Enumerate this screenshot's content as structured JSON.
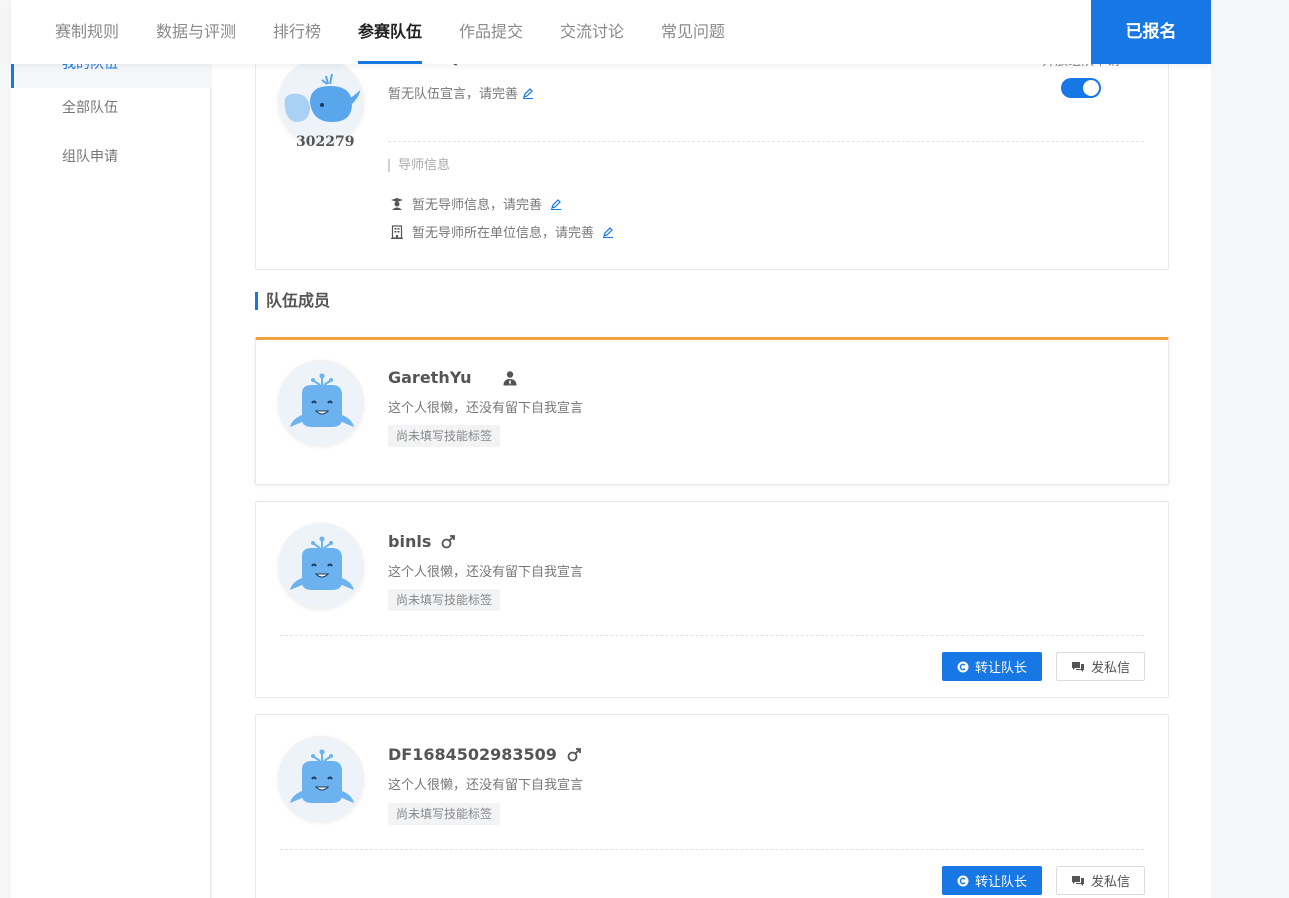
{
  "tabs": [
    {
      "label": "赛制规则",
      "active": false
    },
    {
      "label": "数据与评测",
      "active": false
    },
    {
      "label": "排行榜",
      "active": false
    },
    {
      "label": "参赛队伍",
      "active": true
    },
    {
      "label": "作品提交",
      "active": false
    },
    {
      "label": "交流讨论",
      "active": false
    },
    {
      "label": "常见问题",
      "active": false
    }
  ],
  "signed_label": "已报名",
  "sidebar": {
    "items": [
      {
        "label": "我的队伍",
        "active": true
      },
      {
        "label": "全部队伍",
        "active": false
      },
      {
        "label": "组队申请",
        "active": false
      }
    ]
  },
  "team": {
    "name": "EasonQA",
    "id": "302279",
    "declaration": "暂无队伍宣言，请完善",
    "open_label": "开放组队申请",
    "open_enabled": true,
    "mentor_title": "导师信息",
    "mentor_info": "暂无导师信息，请完善",
    "mentor_org": "暂无导师所在单位信息，请完善"
  },
  "members_title": "队伍成员",
  "members": [
    {
      "name": "GarethYu",
      "role_icon": "leader-icon",
      "sign": "这个人很懒，还没有留下自我宣言",
      "tag": "尚未填写技能标签",
      "is_leader": true
    },
    {
      "name": "binls",
      "gender_icon": "male-icon",
      "sign": "这个人很懒，还没有留下自我宣言",
      "tag": "尚未填写技能标签",
      "is_leader": false,
      "transfer_label": "转让队长",
      "message_label": "发私信"
    },
    {
      "name": "DF1684502983509",
      "gender_icon": "male-icon",
      "sign": "这个人很懒，还没有留下自我宣言",
      "tag": "尚未填写技能标签",
      "is_leader": false,
      "transfer_label": "转让队长",
      "message_label": "发私信"
    }
  ],
  "colors": {
    "accent": "#1677e5",
    "leader_border": "#f0a13c"
  }
}
